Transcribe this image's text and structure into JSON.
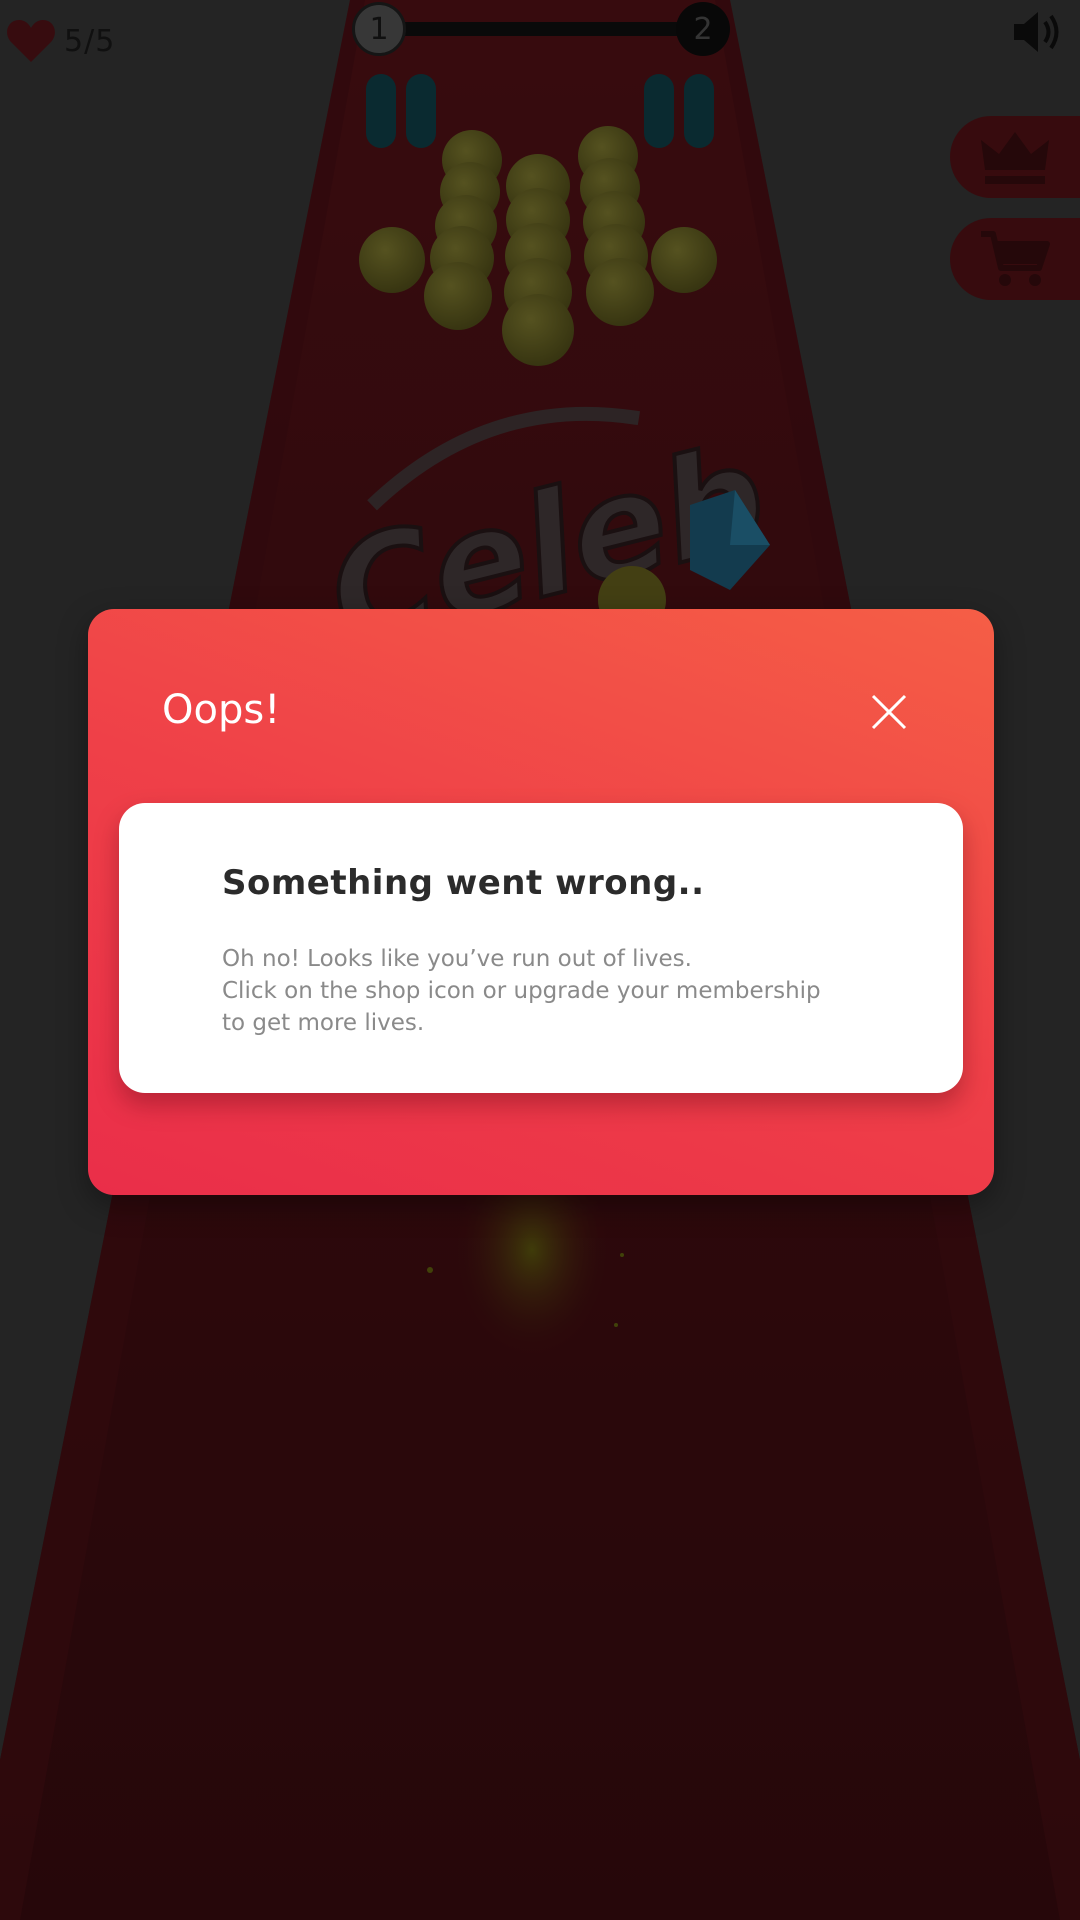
{
  "hud": {
    "lives": "5/5",
    "level_current": "1",
    "level_next": "2",
    "icons": {
      "lives": "heart-icon",
      "sound": "speaker-icon",
      "membership": "crown-icon",
      "shop": "cart-icon"
    }
  },
  "game": {
    "logo_text": "Celeb",
    "track_color": "#5c1419",
    "ball_color": "#6e6a26",
    "gem_color": "#1f6f9a"
  },
  "dialog": {
    "title": "Oops!",
    "heading": "Something went wrong..",
    "message_lines": [
      "Oh no! Looks like you’ve run out of lives.",
      "Click on the shop icon or upgrade your membership",
      "to get more lives."
    ],
    "accent_start": "#ea2e49",
    "accent_end": "#f55e46"
  }
}
